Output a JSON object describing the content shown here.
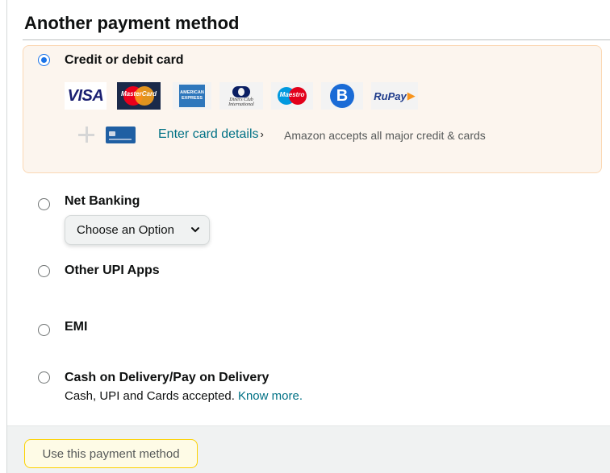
{
  "heading": "Another payment method",
  "credit_card": {
    "label": "Credit or debit card",
    "selected": true,
    "logos": [
      "VISA",
      "MasterCard",
      "AMERICAN EXPRESS",
      "Diners Club International",
      "Maestro",
      "B",
      "RuPay"
    ],
    "enter_link": "Enter card details",
    "chevron": "›",
    "accept_note": "Amazon accepts all major credit & cards"
  },
  "net_banking": {
    "label": "Net Banking",
    "select_value": "Choose an Option"
  },
  "other_upi": {
    "label": "Other UPI Apps"
  },
  "emi": {
    "label": "EMI"
  },
  "cod": {
    "label": "Cash on Delivery/Pay on Delivery",
    "sub_text": "Cash, UPI and Cards accepted.",
    "link": "Know more."
  },
  "footer": {
    "button_label": "Use this payment method"
  },
  "colors": {
    "accent": "#1a73e8",
    "link": "#007185",
    "card_box_bg": "#fcf5ee",
    "card_box_border": "#fbd8b4",
    "button_border": "#fcd200"
  }
}
